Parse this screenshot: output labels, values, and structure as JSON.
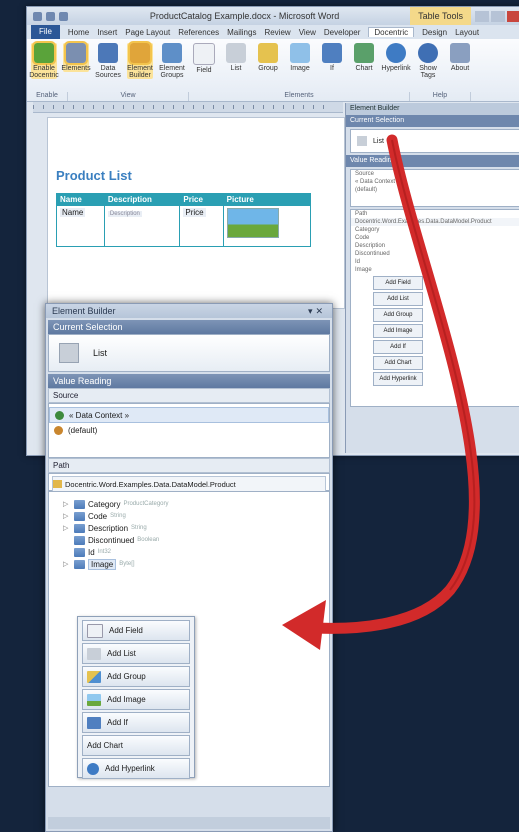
{
  "word": {
    "title": "ProductCatalog Example.docx - Microsoft Word",
    "context_tab": "Table Tools",
    "tabs": [
      "File",
      "Home",
      "Insert",
      "Page Layout",
      "References",
      "Mailings",
      "Review",
      "View",
      "Developer",
      "Docentric",
      "Design",
      "Layout"
    ],
    "ribbon_buttons": [
      "Enable Docentric",
      "Elements",
      "Data Sources",
      "Element Builder",
      "Element Groups",
      "Field",
      "List",
      "Group",
      "Image",
      "If",
      "Chart",
      "Hyperlink",
      "Show Tags",
      "About"
    ],
    "ribbon_groups": [
      "Enable",
      "View",
      "Elements",
      "Help"
    ]
  },
  "document": {
    "heading": "Product List",
    "columns": [
      "Name",
      "Description",
      "Price",
      "Picture"
    ],
    "cells": [
      "Name",
      "Description",
      "Price"
    ]
  },
  "element_builder": {
    "title": "Element Builder",
    "current_selection_header": "Current Selection",
    "current_selection_value": "List",
    "value_reading_header": "Value Reading",
    "source_header": "Source",
    "sources": [
      "« Data Context »",
      "(default)"
    ],
    "path_header": "Path",
    "path_value": "Docentric.Word.Examples.Data.DataModel.Product",
    "tree": [
      {
        "name": "Category",
        "type": "ProductCategory"
      },
      {
        "name": "Code",
        "type": "String"
      },
      {
        "name": "Description",
        "type": "String"
      },
      {
        "name": "Discontinued",
        "type": "Boolean"
      },
      {
        "name": "Id",
        "type": "Int32"
      },
      {
        "name": "Image",
        "type": "Byte[]"
      }
    ],
    "menu": [
      "Add Field",
      "Add List",
      "Add Group",
      "Add Image",
      "Add If",
      "Add Chart",
      "Add Hyperlink"
    ]
  },
  "colors": {
    "background": "#14243c",
    "arrow": "#d22a2a",
    "accent": "#2a9fb3",
    "heading": "#3a7fc0"
  }
}
